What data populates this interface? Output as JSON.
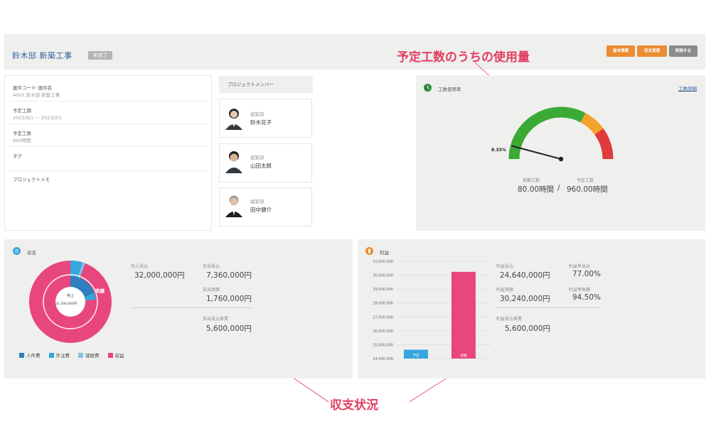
{
  "header": {
    "title": "鈴木邸  新築工事",
    "status": "未完了",
    "buttons": {
      "basic_info": "基本情報",
      "budget": "収支管理",
      "delete": "削除する"
    }
  },
  "annotations": {
    "top": "予定工数のうちの使用量",
    "bottom": "収支状況"
  },
  "info": {
    "code_label": "案件コード･案件名",
    "code_value": "4001 鈴木邸 新築工事",
    "period_label": "予定工期",
    "period_value": "2022/9/1 ～ 2023/3/1",
    "hours_label": "予定工数",
    "hours_value": "960時間",
    "tag_label": "タグ",
    "memo_label": "プロジェクトメモ"
  },
  "members": {
    "title": "プロジェクトメンバー",
    "items": [
      {
        "dept": "建築部",
        "name": "鈴木花子"
      },
      {
        "dept": "建築部",
        "name": "山田太郎"
      },
      {
        "dept": "建築部",
        "name": "田中健介"
      }
    ]
  },
  "gauge": {
    "title": "工数使用率",
    "link": "工数詳細",
    "percent_label": "8.33%",
    "percent": 8.33,
    "actual_caption": "実績工数",
    "planned_caption": "予定工数",
    "actual_value": "80.00時間",
    "separator": "/",
    "planned_value": "960.00時間",
    "colors": {
      "green": "#3aaa35",
      "orange": "#f4a32c",
      "red": "#e03a3a"
    }
  },
  "cashflow": {
    "title": "収支",
    "donut_center_label": "売上",
    "donut_center_value": "32,300,000円",
    "donut_inner_label": "実績",
    "sales_forecast_label": "売上見込",
    "sales_forecast_value": "32,000,000円",
    "expense_forecast_label": "支出見込",
    "expense_forecast_value": "7,360,000円",
    "expense_actual_label": "支出実績",
    "expense_actual_value": "1,760,000円",
    "expense_diff_label": "支出見込差異",
    "expense_diff_value": "5,600,000円",
    "legend": [
      {
        "label": "人件費",
        "color": "#2f7fbf"
      },
      {
        "label": "外注費",
        "color": "#36a6dc"
      },
      {
        "label": "諸経費",
        "color": "#7cc5e8"
      },
      {
        "label": "収益",
        "color": "#e8477e"
      }
    ]
  },
  "profit": {
    "title": "利益",
    "profit_forecast_label": "利益見込",
    "profit_forecast_value": "24,640,000円",
    "margin_forecast_label": "利益率見込",
    "margin_forecast_value": "77.00%",
    "profit_actual_label": "利益実績",
    "profit_actual_value": "30,240,000円",
    "margin_actual_label": "利益率実績",
    "margin_actual_value": "94.50%",
    "profit_diff_label": "利益見込差異",
    "profit_diff_value": "5,600,000円"
  },
  "chart_data": {
    "type": "bar",
    "categories": [
      "予定",
      "実績"
    ],
    "values": [
      24640000,
      30240000
    ],
    "colors": [
      "#36a6dc",
      "#e8477e"
    ],
    "ylim": [
      24000000,
      31000000
    ],
    "yticks": [
      "24,000,000",
      "25,000,000",
      "26,000,000",
      "27,000,000",
      "28,000,000",
      "29,000,000",
      "30,000,000",
      "31,000,000"
    ],
    "grid": true
  }
}
